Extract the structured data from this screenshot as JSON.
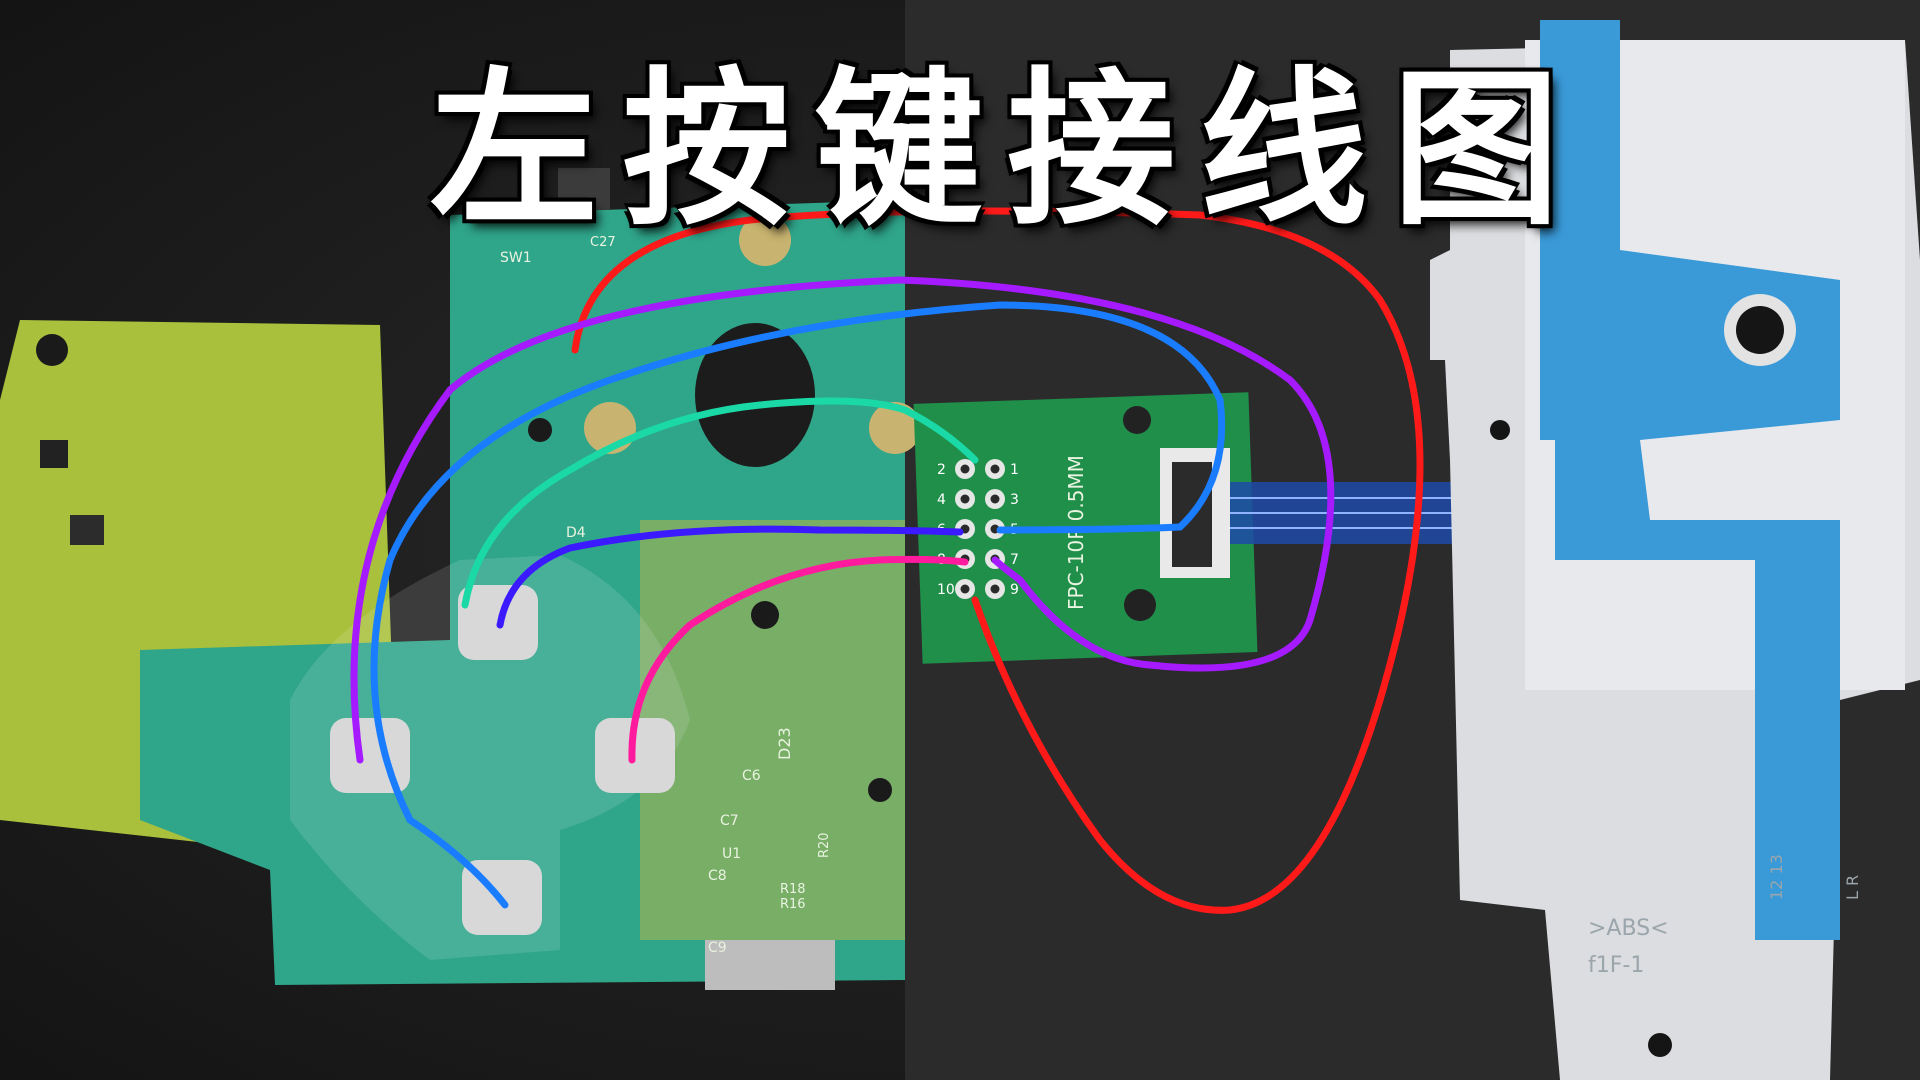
{
  "title_chars": [
    "左",
    "按",
    "键",
    "接",
    "线",
    "图"
  ],
  "adapter": {
    "label_fpc": "FPC-10P 0.5MM",
    "pin_labels": [
      "1",
      "2",
      "3",
      "4",
      "5",
      "6",
      "7",
      "8",
      "9",
      "10"
    ]
  },
  "pcb_labels": {
    "sw1": "SW1",
    "c27": "C27",
    "d4": "D4",
    "d23": "D23",
    "c6": "C6",
    "c7": "C7",
    "c8": "C8",
    "c9": "C9",
    "u1": "U1",
    "r16": "R16",
    "r18": "R18",
    "r20": "R20"
  },
  "shell_labels": {
    "abs": ">ABS<",
    "part": "f1F-1",
    "mark_a": "12 13",
    "mark_b": "L R"
  },
  "colors": {
    "background": "#1f1f1f",
    "pcb_green": "#2fa58a",
    "pcb_yellow": "#a9c03c",
    "wire_red": "#ff1a1a",
    "wire_purple": "#a61aff",
    "wire_blue": "#1a7dff",
    "wire_teal": "#1ad9a6",
    "wire_indigo": "#3b1aff",
    "wire_pink": "#ff1a9e"
  }
}
